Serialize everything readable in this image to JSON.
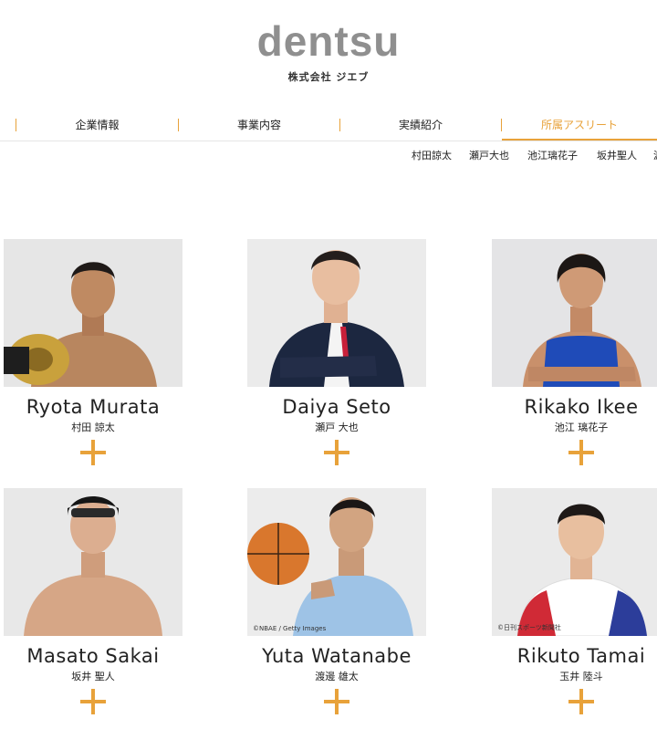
{
  "header": {
    "logo": "dentsu",
    "subtitle": "株式会社 ジエブ"
  },
  "nav": {
    "items": [
      {
        "label": "企業情報",
        "active": false
      },
      {
        "label": "事業内容",
        "active": false
      },
      {
        "label": "実績紹介",
        "active": false
      },
      {
        "label": "所属アスリート",
        "active": true
      }
    ],
    "accent_color": "#e8a23a"
  },
  "subnav": {
    "items": [
      "村田諒太",
      "瀬戸大也",
      "池江璃花子",
      "坂井聖人",
      "渡"
    ]
  },
  "athletes": [
    {
      "name_en": "Ryota Murata",
      "name_jp": "村田 諒太",
      "credit": ""
    },
    {
      "name_en": "Daiya Seto",
      "name_jp": "瀬戸 大也",
      "credit": ""
    },
    {
      "name_en": "Rikako Ikee",
      "name_jp": "池江 璃花子",
      "credit": ""
    },
    {
      "name_en": "Masato Sakai",
      "name_jp": "坂井 聖人",
      "credit": ""
    },
    {
      "name_en": "Yuta Watanabe",
      "name_jp": "渡邊 雄太",
      "credit": "©NBAE / Getty Images"
    },
    {
      "name_en": "Rikuto Tamai",
      "name_jp": "玉井 陸斗",
      "credit": "©日刊スポーツ新聞社"
    }
  ],
  "icons": {
    "expand": "plus-icon"
  }
}
